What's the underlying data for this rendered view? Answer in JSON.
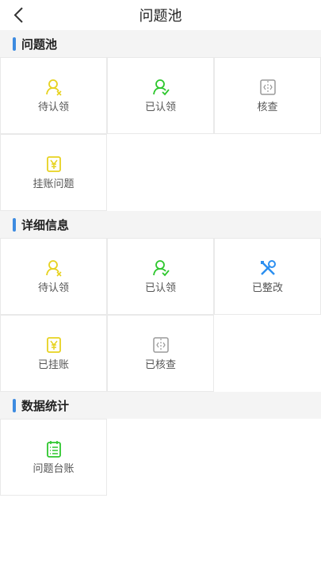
{
  "header": {
    "title": "问题池",
    "back_icon": "chevron-left-icon"
  },
  "sections": [
    {
      "label": "问题池",
      "items": [
        {
          "label": "待认领",
          "icon": "user-pending-icon",
          "color": "#e7d21f"
        },
        {
          "label": "已认领",
          "icon": "user-check-icon",
          "color": "#2dc72d"
        },
        {
          "label": "核查",
          "icon": "inspect-icon",
          "color": "#9a9a9a"
        },
        {
          "label": "挂账问题",
          "icon": "ledger-yen-icon",
          "color": "#e7d21f"
        }
      ]
    },
    {
      "label": "详细信息",
      "items": [
        {
          "label": "待认领",
          "icon": "user-pending-icon",
          "color": "#e7d21f"
        },
        {
          "label": "已认领",
          "icon": "user-check-icon",
          "color": "#2dc72d"
        },
        {
          "label": "已整改",
          "icon": "tools-icon",
          "color": "#2c8ff0"
        },
        {
          "label": "已挂账",
          "icon": "ledger-yen-icon",
          "color": "#e7d21f"
        },
        {
          "label": "已核查",
          "icon": "inspect-icon",
          "color": "#9a9a9a"
        }
      ]
    },
    {
      "label": "数据统计",
      "items": [
        {
          "label": "问题台账",
          "icon": "list-document-icon",
          "color": "#2dc72d"
        }
      ]
    }
  ]
}
